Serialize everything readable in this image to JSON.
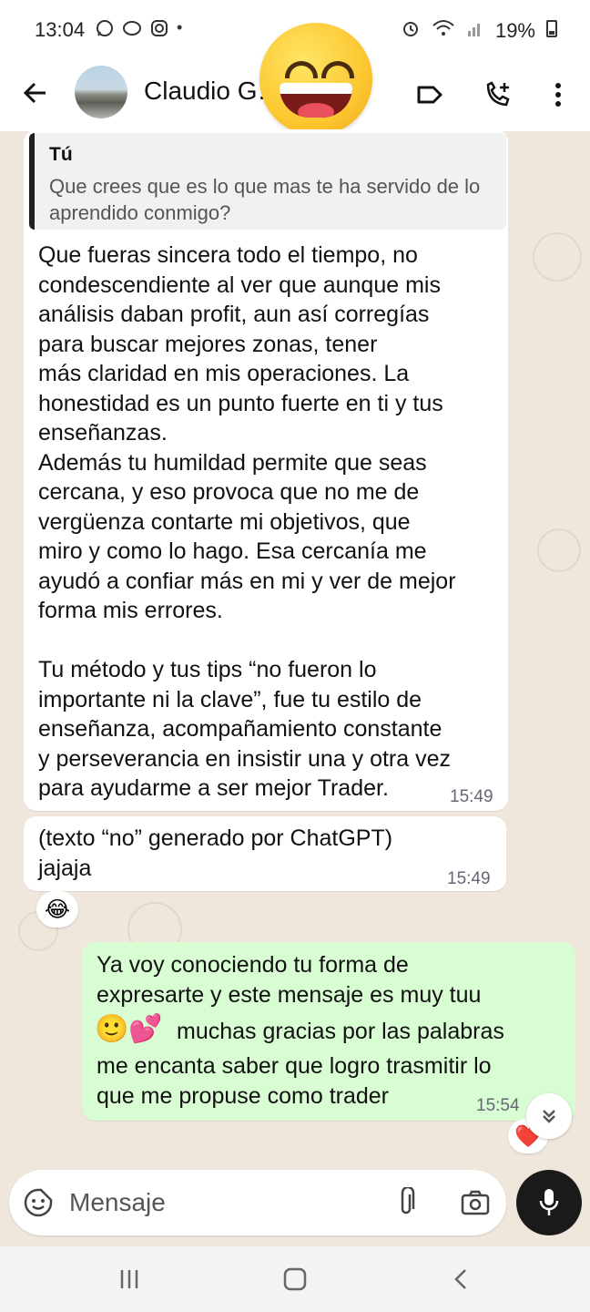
{
  "status_bar": {
    "time": "13:04",
    "battery": "19%"
  },
  "header": {
    "contact_name": "Claudio G… …"
  },
  "quote": {
    "author": "Tú",
    "text": "Que crees que es lo que mas te ha servido de lo aprendido conmigo?"
  },
  "messages": [
    {
      "text": "Que fueras sincera todo el tiempo, no\ncondescendiente al ver que aunque mis\nanálisis daban profit, aun así corregías\npara buscar mejores zonas, tener\nmás claridad en mis operaciones. La\nhonestidad es un punto fuerte en ti y tus\nenseñanzas.\nAdemás tu humildad permite que seas\ncercana, y eso provoca que no me de\nvergüenza contarte mi objetivos, que\nmiro y como lo hago.  Esa cercanía me\nayudó a confiar más en mi y ver de mejor\nforma mis errores.\n\nTu método y tus tips “no fueron lo\nimportante ni la clave”, fue tu estilo de\nenseñanza, acompañamiento constante\ny perseverancia en insistir una y otra vez\npara ayudarme a ser mejor Trader.",
      "time": "15:49"
    },
    {
      "text": "(texto “no” generado por ChatGPT)\njajaja",
      "time": "15:49",
      "reaction": "😂"
    },
    {
      "text_line1": "Ya voy conociendo tu forma de",
      "text_line2": "expresarte y este mensaje es muy tuu",
      "emojis": "🙂💕",
      "text_line3": "muchas gracias por las palabras",
      "text_rest": "me encanta saber que logro trasmitir lo\nque me propuse como trader",
      "time": "15:54",
      "reaction": "❤️"
    }
  ],
  "composer": {
    "placeholder": "Mensaje"
  }
}
